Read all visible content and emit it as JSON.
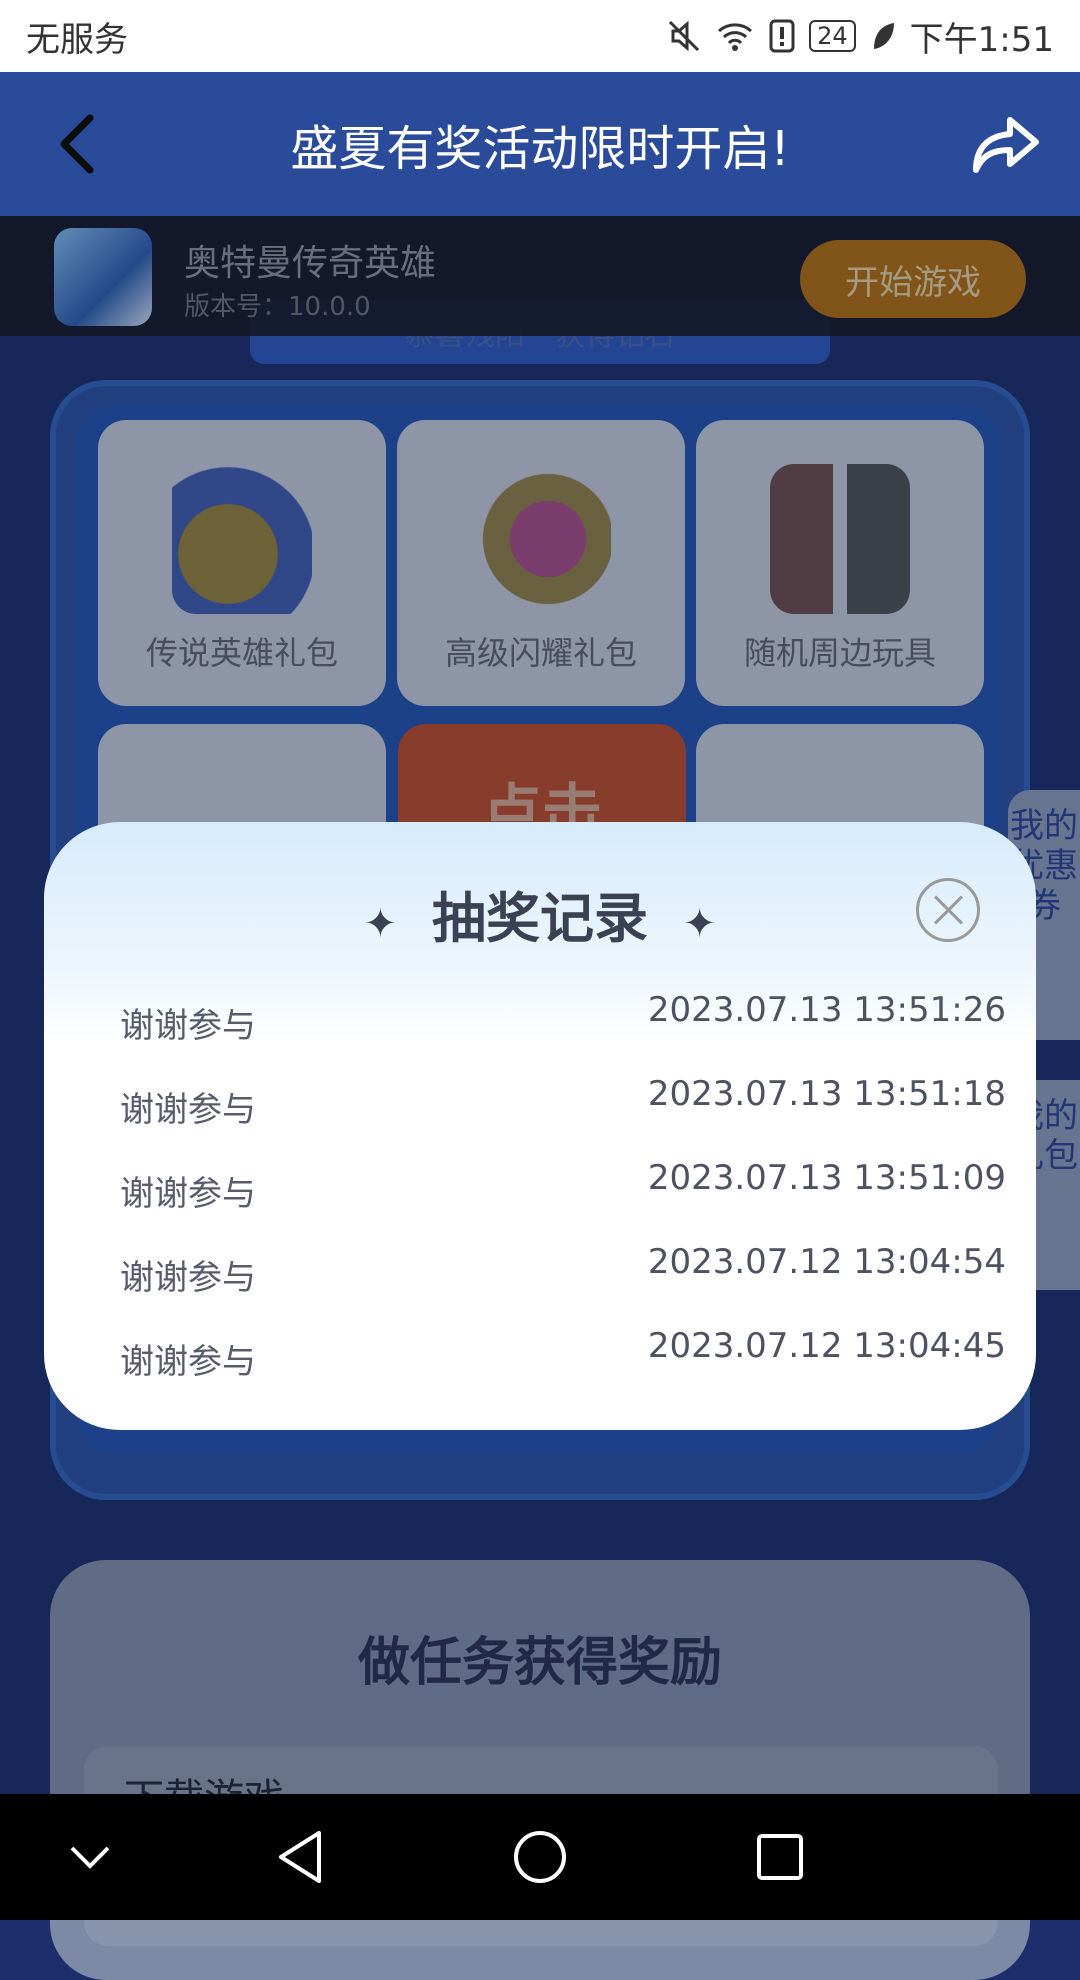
{
  "status_bar": {
    "carrier": "无服务",
    "battery": "24",
    "time": "下午1:51"
  },
  "title_bar": {
    "title": "盛夏有奖活动限时开启!"
  },
  "game": {
    "name": "奥特曼传奇英雄",
    "version": "版本号：10.0.0",
    "start_label": "开始游戏"
  },
  "notice": "恭喜残阳**获得钻石",
  "prizes": [
    "传说英雄礼包",
    "高级闪耀礼包",
    "随机周边玩具"
  ],
  "click_label": "点击",
  "side_tabs": {
    "coupons": "我的优惠券",
    "gifts": "我的礼包"
  },
  "task_section": {
    "title": "做任务获得奖励",
    "item_label": "下载游戏"
  },
  "dialog": {
    "title": "抽奖记录",
    "records": [
      {
        "name": "谢谢参与",
        "time": "2023.07.13 13:51:26"
      },
      {
        "name": "谢谢参与",
        "time": "2023.07.13 13:51:18"
      },
      {
        "name": "谢谢参与",
        "time": "2023.07.13 13:51:09"
      },
      {
        "name": "谢谢参与",
        "time": "2023.07.12 13:04:54"
      },
      {
        "name": "谢谢参与",
        "time": "2023.07.12 13:04:45"
      }
    ]
  },
  "icons": {
    "back": "chevron-left-icon",
    "share": "share-icon",
    "close": "close-icon",
    "nav_down": "chevron-down-icon",
    "nav_back": "triangle-back-icon",
    "nav_home": "circle-home-icon",
    "nav_recent": "square-recent-icon"
  }
}
